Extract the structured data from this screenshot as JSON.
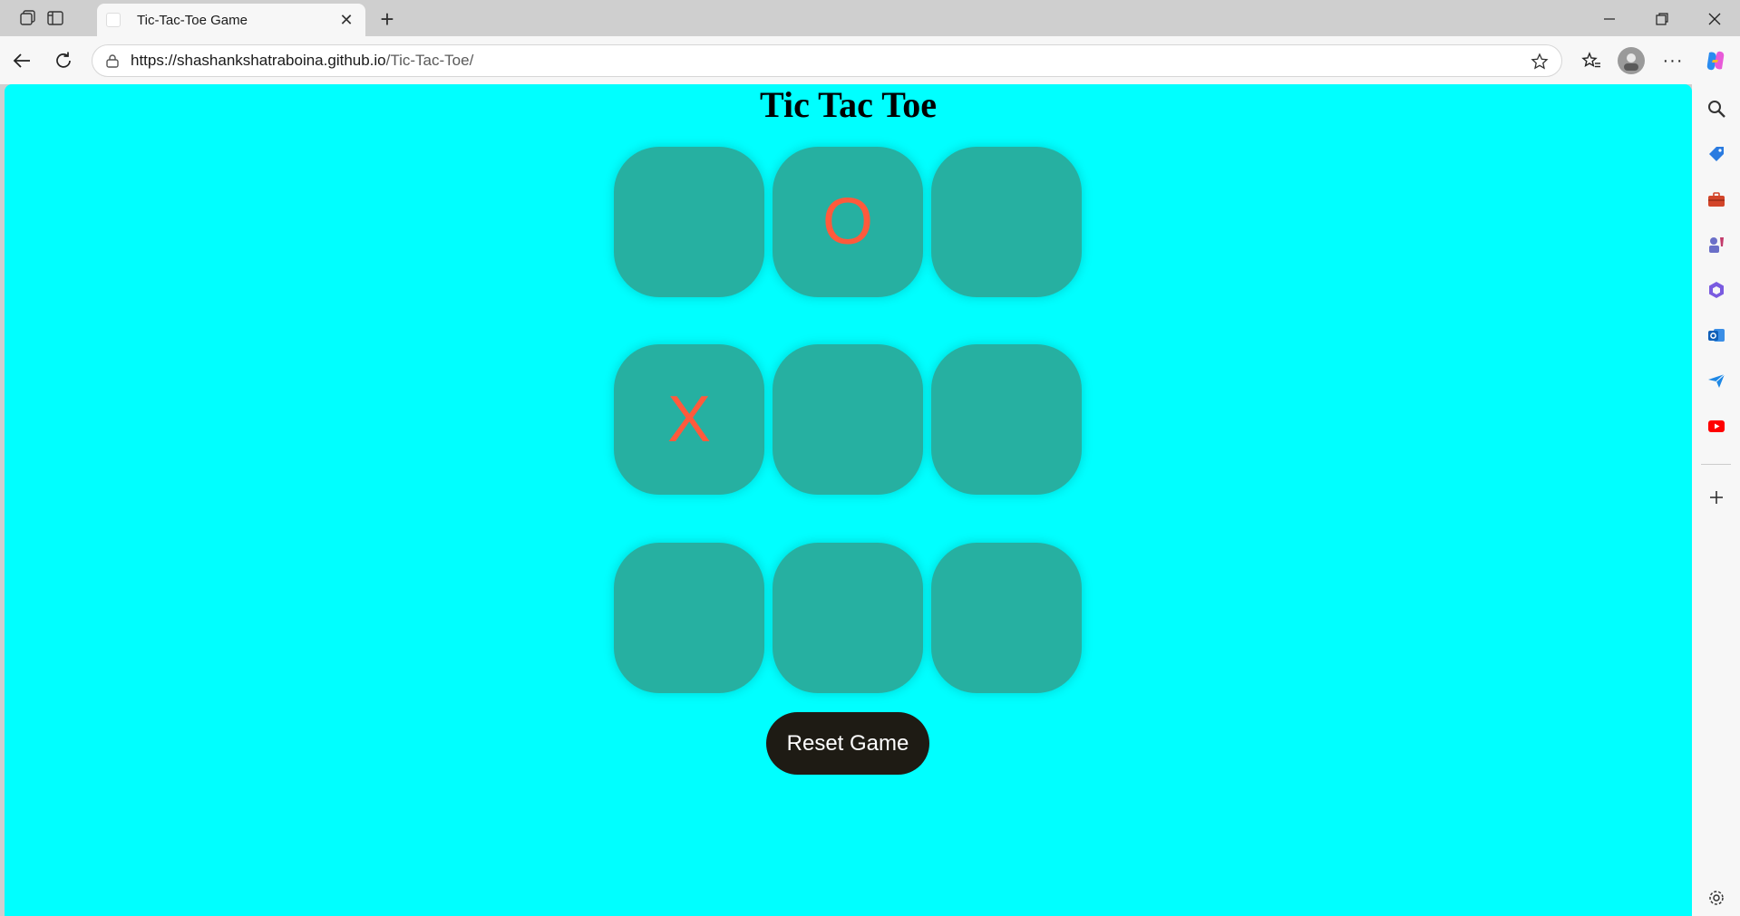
{
  "browser": {
    "tab_title": "Tic-Tac-Toe Game",
    "url_host": "https://shashankshatraboina.github.io",
    "url_path": "/Tic-Tac-Toe/"
  },
  "page": {
    "title": "Tic Tac Toe",
    "reset_label": "Reset Game",
    "board": [
      "",
      "O",
      "",
      "X",
      "",
      "",
      "",
      "",
      ""
    ],
    "colors": {
      "background": "#00ffff",
      "cell": "#26b0a1",
      "mark": "#ff5a3c",
      "reset_button": "#1e1b14"
    }
  },
  "sidebar_icons": [
    "search-icon",
    "shopping-tag-icon",
    "tools-icon",
    "games-icon",
    "microsoft365-icon",
    "outlook-icon",
    "send-icon",
    "youtube-icon",
    "add-icon",
    "settings-icon"
  ]
}
